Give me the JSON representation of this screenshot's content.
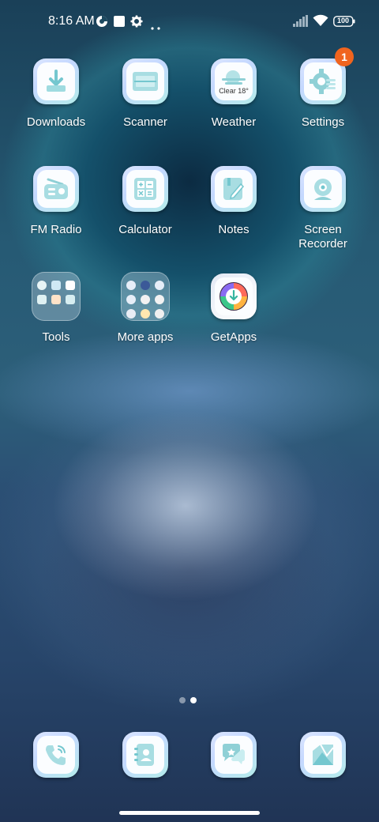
{
  "status_bar": {
    "time": "8:16 AM",
    "battery": "100",
    "icons": [
      "data-saver-icon",
      "square-notification-icon",
      "gear-icon",
      "more-dots-icon",
      "signal-icon",
      "wifi-icon",
      "battery-icon"
    ]
  },
  "apps": [
    {
      "label": "Downloads",
      "icon": "download-icon"
    },
    {
      "label": "Scanner",
      "icon": "scanner-icon"
    },
    {
      "label": "Weather",
      "icon": "weather-icon",
      "sublabel": "Clear 18°"
    },
    {
      "label": "Settings",
      "icon": "settings-icon",
      "badge": "1"
    },
    {
      "label": "FM Radio",
      "icon": "radio-icon"
    },
    {
      "label": "Calculator",
      "icon": "calculator-icon"
    },
    {
      "label": "Notes",
      "icon": "notes-icon"
    },
    {
      "label": "Screen Recorder",
      "icon": "screen-recorder-icon"
    },
    {
      "label": "Tools",
      "icon": "folder-icon"
    },
    {
      "label": "More apps",
      "icon": "folder-icon"
    },
    {
      "label": "GetApps",
      "icon": "getapps-icon"
    }
  ],
  "page_indicator": {
    "count": 2,
    "active": 2
  },
  "dock": [
    {
      "icon": "phone-icon"
    },
    {
      "icon": "contacts-icon"
    },
    {
      "icon": "messaging-icon"
    },
    {
      "icon": "gallery-icon"
    }
  ],
  "colors": {
    "badge": "#f0641e",
    "icon_accent": "#74c7cf"
  }
}
